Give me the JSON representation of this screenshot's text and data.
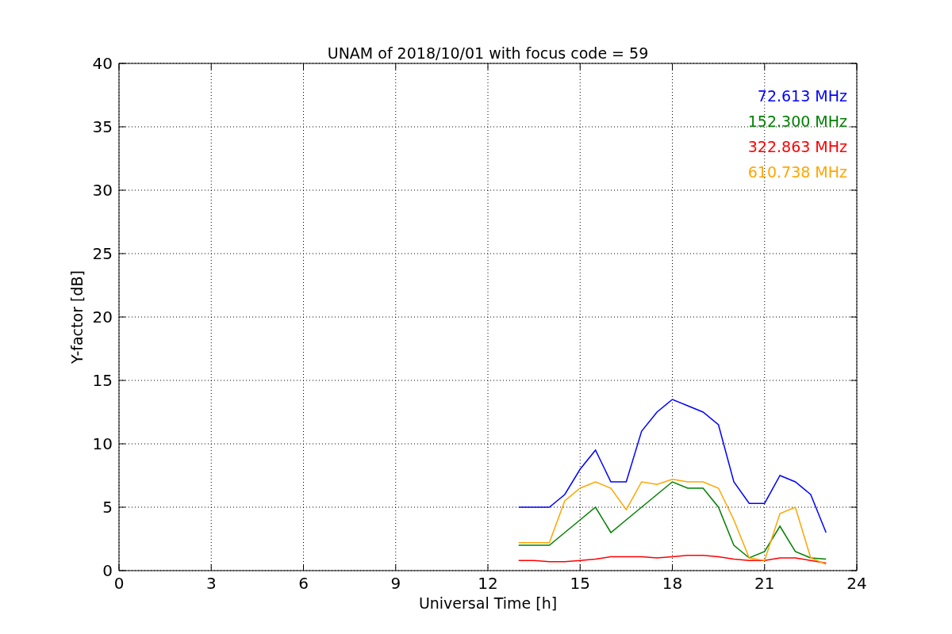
{
  "chart_data": {
    "type": "line",
    "title": "UNAM of 2018/10/01 with focus code = 59",
    "xlabel": "Universal Time [h]",
    "ylabel": "Y-factor [dB]",
    "x": [
      13,
      13.5,
      14,
      14.5,
      15,
      15.5,
      16,
      16.5,
      17,
      17.5,
      18,
      18.5,
      19,
      19.5,
      20,
      20.5,
      21,
      21.5,
      22,
      22.5,
      23
    ],
    "series": [
      {
        "name": "72.613 MHz",
        "color": "#0000ff",
        "values": [
          5,
          5,
          5,
          6,
          8,
          9.5,
          7,
          7,
          11,
          12.5,
          13.5,
          13,
          12.5,
          11.5,
          7,
          5.3,
          5.3,
          7.5,
          7,
          6,
          3
        ]
      },
      {
        "name": "152.300 MHz",
        "color": "#008000",
        "values": [
          2,
          2,
          2,
          3,
          4,
          5,
          3,
          4,
          5,
          6,
          7,
          6.5,
          6.5,
          5,
          2,
          1,
          1.5,
          3.5,
          1.5,
          1,
          0.9
        ]
      },
      {
        "name": "322.863 MHz",
        "color": "#ff0000",
        "values": [
          0.8,
          0.8,
          0.7,
          0.7,
          0.8,
          0.9,
          1.1,
          1.1,
          1.1,
          1,
          1.1,
          1.2,
          1.2,
          1.1,
          0.9,
          0.8,
          0.8,
          1,
          1,
          0.8,
          0.6
        ]
      },
      {
        "name": "610.738 MHz",
        "color": "#ffa500",
        "values": [
          2.2,
          2.2,
          2.2,
          5.5,
          6.5,
          7,
          6.5,
          4.8,
          7,
          6.8,
          7.2,
          7,
          7,
          6.5,
          4,
          1,
          0.8,
          4.5,
          5,
          1,
          0.5
        ]
      }
    ],
    "xlim": [
      0,
      24
    ],
    "ylim": [
      0,
      40
    ],
    "xticks": [
      0,
      3,
      6,
      9,
      12,
      15,
      18,
      21,
      24
    ],
    "yticks": [
      0,
      5,
      10,
      15,
      20,
      25,
      30,
      35,
      40
    ],
    "grid": true
  }
}
